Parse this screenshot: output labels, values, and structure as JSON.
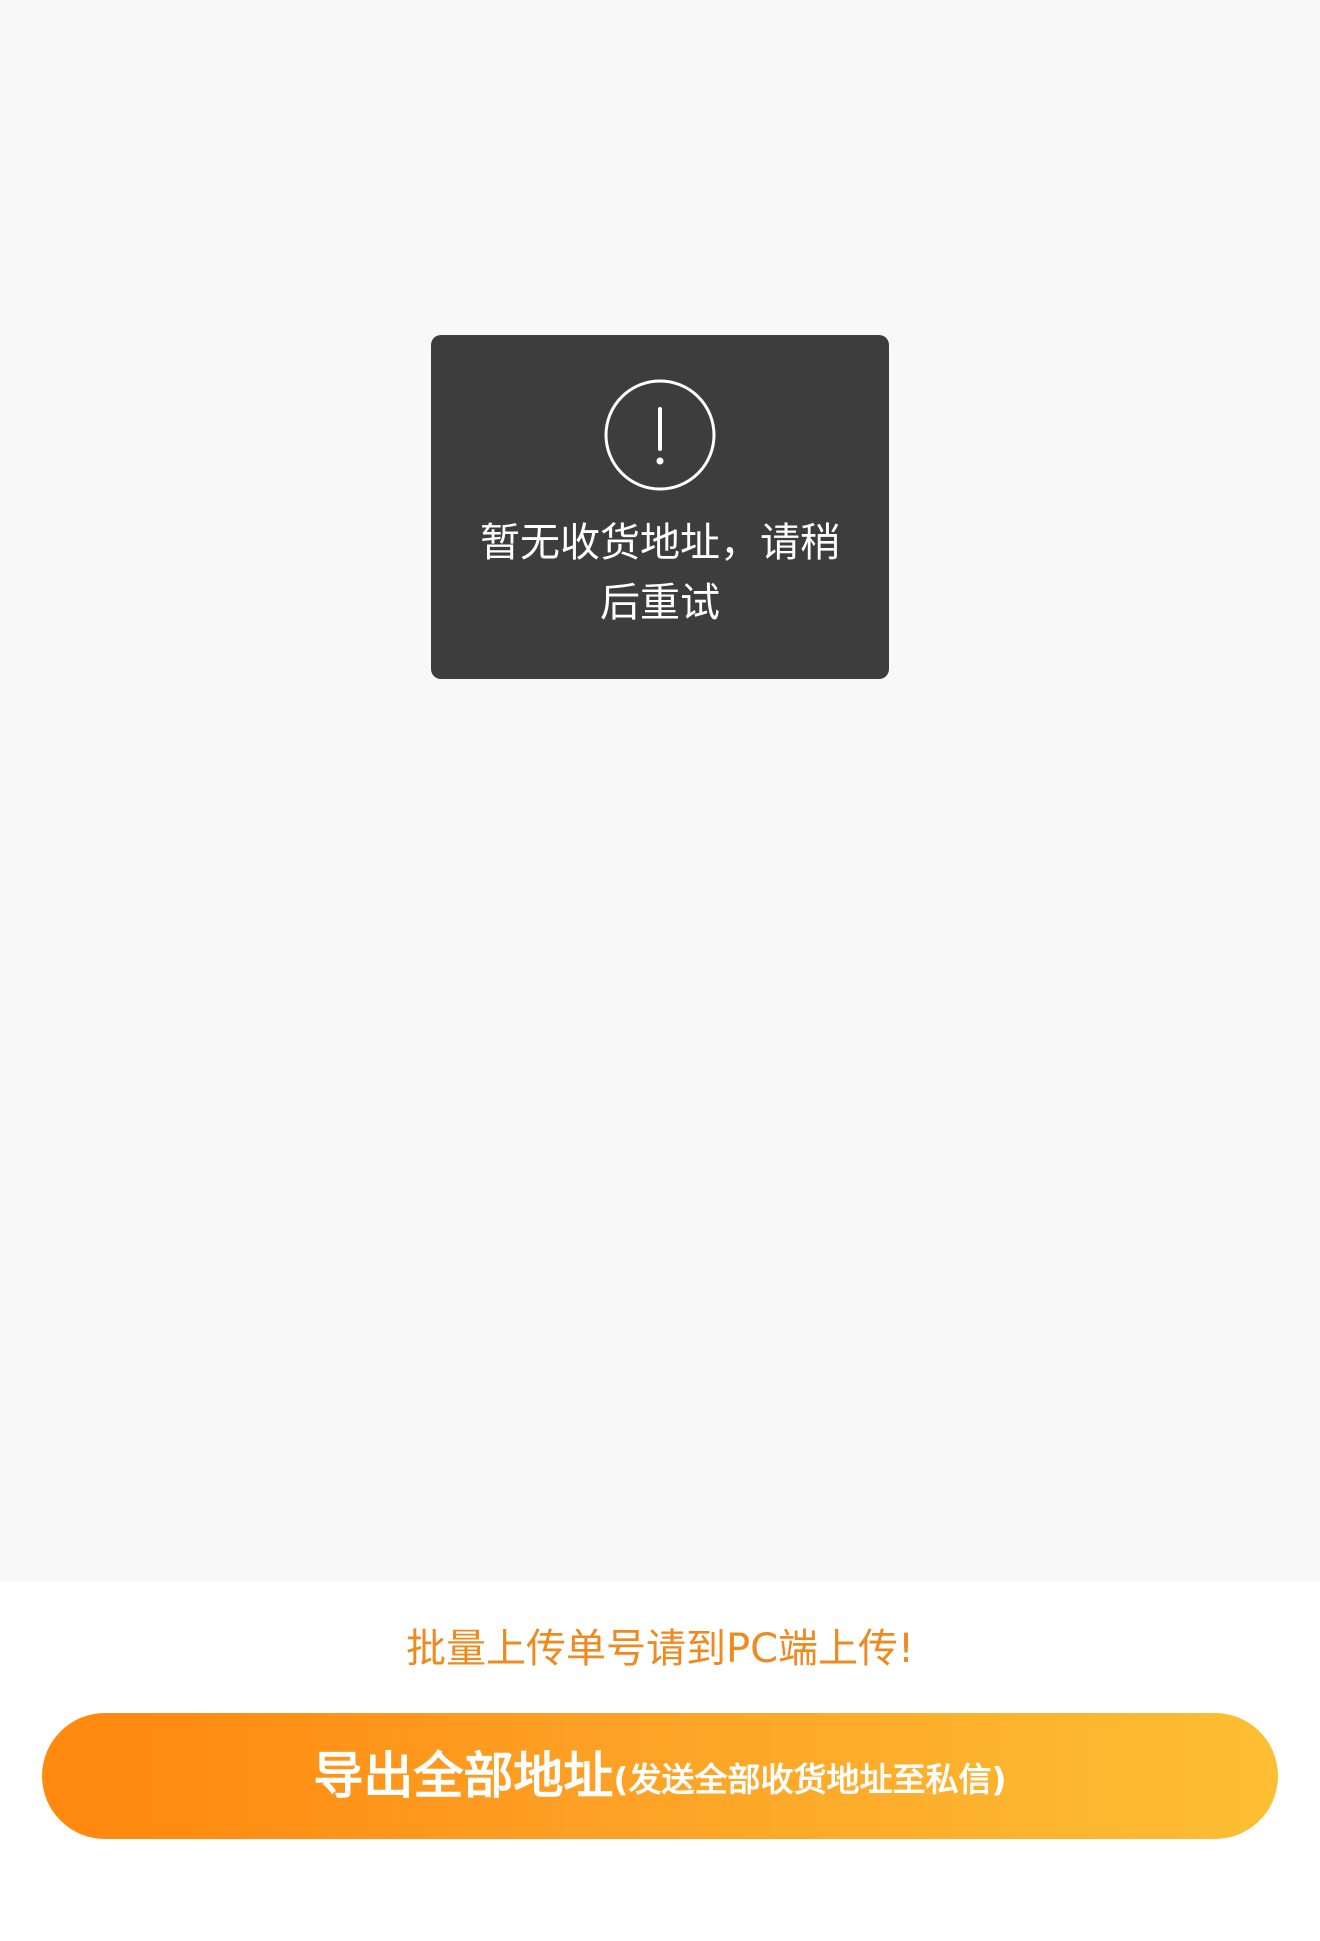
{
  "toast": {
    "icon": "exclamation-circle-icon",
    "message": "暂无收货地址，请稍后重试"
  },
  "footer": {
    "notice": "批量上传单号请到PC端上传!",
    "export_label": "导出全部地址",
    "export_note": "(发送全部收货地址至私信)"
  },
  "colors": {
    "notice": "#ee8a1f",
    "button_gradient_start": "#ff8a0f",
    "button_gradient_end": "#fdbf33",
    "toast_bg": "#3d3d3d",
    "page_bg": "#f8f8f8"
  }
}
